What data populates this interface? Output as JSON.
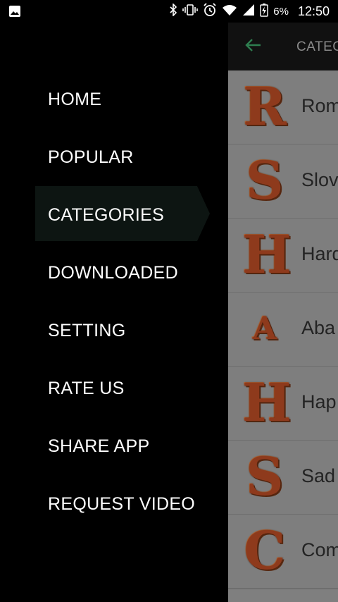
{
  "status_bar": {
    "battery_percent": "6%",
    "time": "12:50",
    "icons": [
      "image-icon",
      "bluetooth-icon",
      "vibrate-icon",
      "alarm-icon",
      "wifi-icon",
      "signal-icon",
      "battery-charging-icon"
    ]
  },
  "toolbar": {
    "title": "CATEG",
    "back_icon": "arrow-left-icon",
    "accent": "#2e7d4f"
  },
  "categories": [
    {
      "letter": "R",
      "name": "Rom"
    },
    {
      "letter": "S",
      "name": "Slov"
    },
    {
      "letter": "H",
      "name": "Hard"
    },
    {
      "letter": "A",
      "name": "Aba"
    },
    {
      "letter": "H",
      "name": "Hap"
    },
    {
      "letter": "S",
      "name": "Sad"
    },
    {
      "letter": "C",
      "name": "Com"
    }
  ],
  "drawer": {
    "items": [
      {
        "label": "HOME"
      },
      {
        "label": "POPULAR"
      },
      {
        "label": "CATEGORIES",
        "selected": true
      },
      {
        "label": "DOWNLOADED"
      },
      {
        "label": "SETTING"
      },
      {
        "label": "RATE US"
      },
      {
        "label": "SHARE APP"
      },
      {
        "label": "REQUEST VIDEO"
      }
    ]
  }
}
